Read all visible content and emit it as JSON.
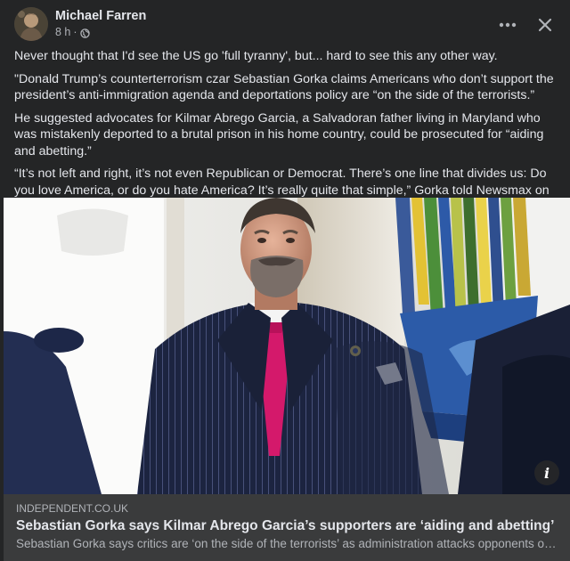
{
  "post": {
    "author": "Michael Farren",
    "time": "8 h",
    "separator": "·",
    "audience_icon": "globe-icon",
    "more_icon": "more-horizontal-icon",
    "close_icon": "close-icon",
    "paragraphs": [
      "Never thought that I'd see the US go 'full tyranny', but... hard to see this any other way.",
      "\"Donald Trump’s counterterrorism czar Sebastian Gorka claims Americans who don’t support the president’s anti-immigration agenda and deportations policy are “on the side of the terrorists.”",
      "He suggested advocates for Kilmar Abrego Garcia, a Salvadoran father living in Maryland who was mistakenly deported to a brutal prison in his home country, could be prosecuted for “aiding and abetting.”",
      "“It’s not left and right, it’s not even Republican or Democrat. There’s one line that divides us: Do you love America, or do you hate America? It’s really quite that simple,” Gorka told Newsmax on Wednesday.\""
    ]
  },
  "link": {
    "domain": "INDEPENDENT.CO.UK",
    "title": "Sebastian Gorka says Kilmar Abrego Garcia’s supporters are ‘aiding and abetting’",
    "description": "Sebastian Gorka says critics are ‘on the side of the terrorists’ as administration attacks opponents of p...",
    "info_label": "i"
  },
  "colors": {
    "background": "#242526",
    "card": "#3a3b3c",
    "text_primary": "#e4e6eb",
    "text_secondary": "#b0b3b8",
    "tie": "#d4196b"
  }
}
